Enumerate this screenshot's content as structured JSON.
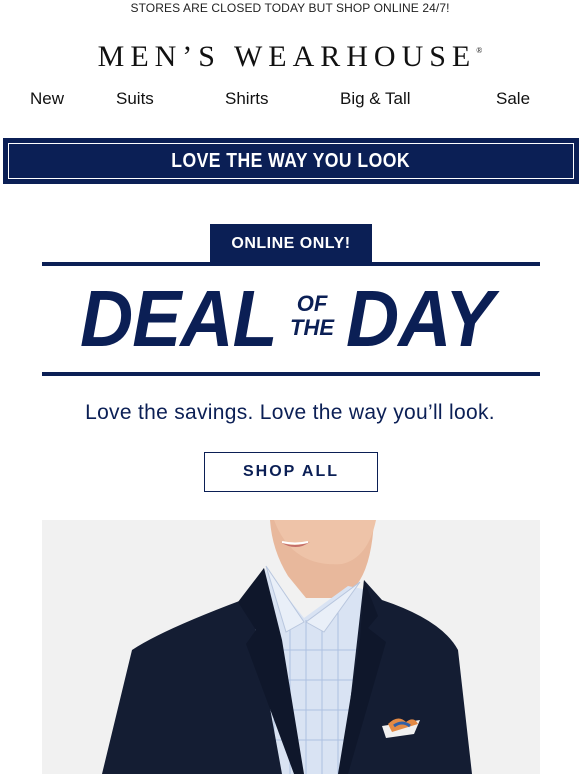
{
  "topbar": {
    "text": "STORES ARE CLOSED TODAY BUT SHOP ONLINE 24/7!"
  },
  "brand": {
    "name": "MEN’S WEARHOUSE",
    "mark": "®"
  },
  "nav": {
    "items": [
      "New",
      "Suits",
      "Shirts",
      "Big & Tall",
      "Sale"
    ]
  },
  "banner": {
    "text": "LOVE THE WAY YOU LOOK"
  },
  "promo": {
    "badge": "ONLINE ONLY!",
    "headline_left": "DEAL",
    "headline_of": "OF",
    "headline_the": "THE",
    "headline_right": "DAY",
    "tagline": "Love the savings. Love the way you’ll look.",
    "cta": "SHOP ALL"
  },
  "colors": {
    "navy": "#0b1f55",
    "photo_bg": "#f1f1f1"
  },
  "hero": {
    "icon": "man-in-navy-suit-photo"
  }
}
